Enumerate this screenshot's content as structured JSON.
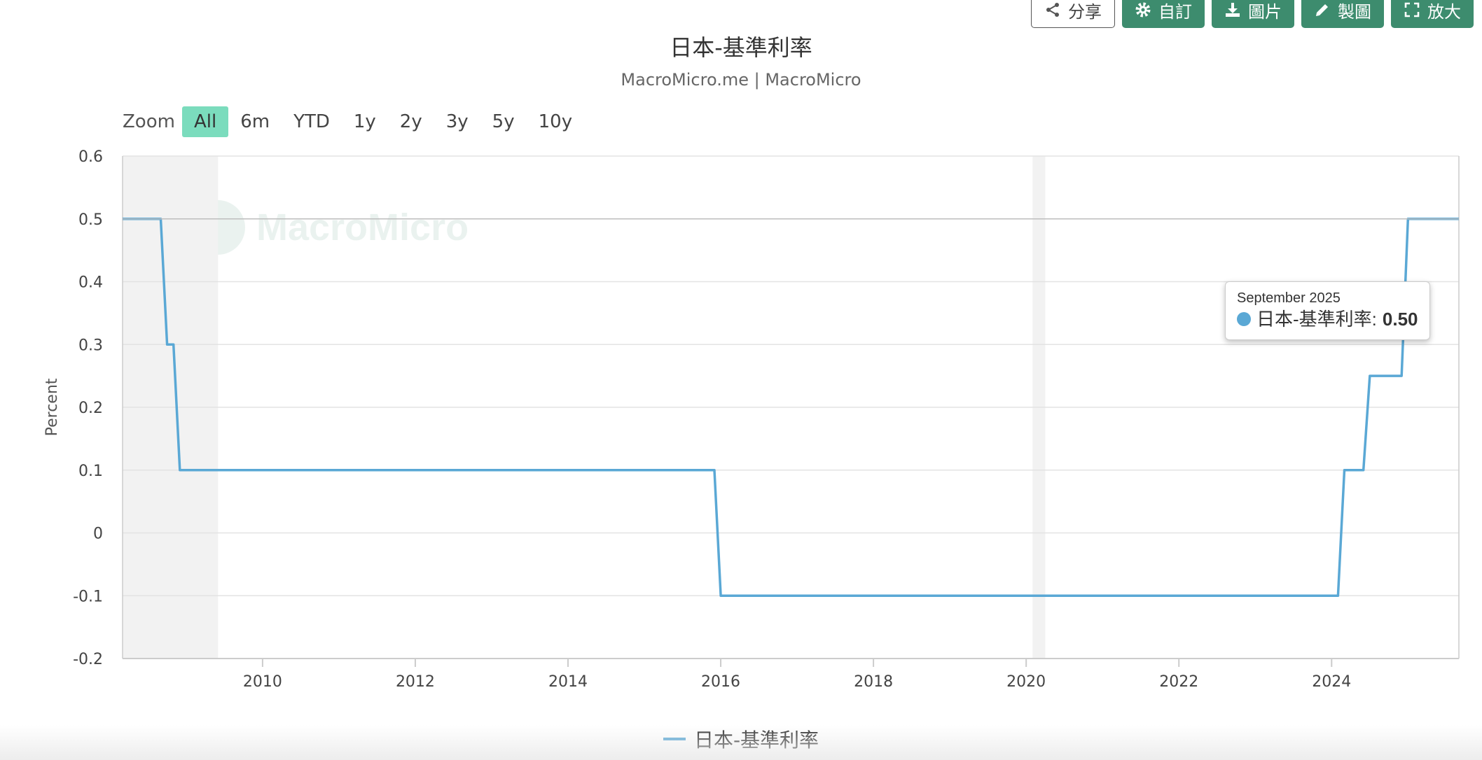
{
  "toolbar": {
    "buttons": [
      {
        "label": "分享",
        "icon": "share-icon"
      },
      {
        "label": "自訂",
        "icon": "gear-icon"
      },
      {
        "label": "圖片",
        "icon": "download-icon"
      },
      {
        "label": "製圖",
        "icon": "pencil-icon"
      },
      {
        "label": "放大",
        "icon": "expand-icon"
      }
    ]
  },
  "zoom": {
    "label": "Zoom",
    "options": [
      "All",
      "6m",
      "YTD",
      "1y",
      "2y",
      "3y",
      "5y",
      "10y"
    ],
    "selected": "All"
  },
  "watermark": "MacroMicro",
  "tooltip": {
    "date": "September 2025",
    "series_name": "日本-基準利率",
    "value": "0.50"
  },
  "colors": {
    "series": "#5aa8d5",
    "button": "#3d8c6e",
    "zoom_active": "#7bdcbd",
    "recession_band": "#f2f2f2"
  },
  "chart_data": {
    "type": "line",
    "title": "日本-基準利率",
    "subtitle": "MacroMicro.me | MacroMicro",
    "ylabel": "Percent",
    "ylim": [
      -0.2,
      0.6
    ],
    "yticks": [
      "0.6",
      "0.5",
      "0.4",
      "0.3",
      "0.2",
      "0.1",
      "0",
      "-0.1",
      "-0.2"
    ],
    "xticks": [
      "2010",
      "2012",
      "2014",
      "2016",
      "2018",
      "2020",
      "2022",
      "2024"
    ],
    "xlim": [
      "2008-03",
      "2025-09"
    ],
    "grid": true,
    "legend": "bottom-center",
    "shaded_periods": [
      {
        "start": "2008-03",
        "end": "2009-06"
      },
      {
        "start": "2020-02",
        "end": "2020-04"
      }
    ],
    "series": [
      {
        "name": "日本-基準利率",
        "step": true,
        "points": [
          {
            "x": "2008-03",
            "y": 0.5
          },
          {
            "x": "2008-09",
            "y": 0.5
          },
          {
            "x": "2008-10",
            "y": 0.3
          },
          {
            "x": "2008-11",
            "y": 0.3
          },
          {
            "x": "2008-12",
            "y": 0.1
          },
          {
            "x": "2015-12",
            "y": 0.1
          },
          {
            "x": "2016-01",
            "y": -0.1
          },
          {
            "x": "2024-02",
            "y": -0.1
          },
          {
            "x": "2024-03",
            "y": 0.1
          },
          {
            "x": "2024-06",
            "y": 0.1
          },
          {
            "x": "2024-07",
            "y": 0.25
          },
          {
            "x": "2024-12",
            "y": 0.25
          },
          {
            "x": "2025-01",
            "y": 0.5
          },
          {
            "x": "2025-09",
            "y": 0.5
          }
        ]
      }
    ]
  }
}
